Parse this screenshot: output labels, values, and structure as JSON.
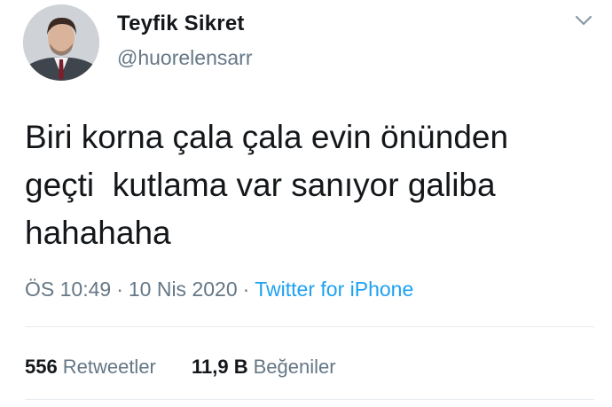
{
  "user": {
    "display_name": "Teyfik Sikret",
    "handle": "@huorelensarr"
  },
  "icons": {
    "avatar": "profile-photo",
    "caret": "chevron-down-icon"
  },
  "tweet": {
    "text": "Biri korna çala çala evin önünden\ngeçti  kutlama var sanıyor galiba\nhahahaha",
    "time": "ÖS 10:49",
    "date": "10 Nis 2020",
    "separator": "·",
    "source": "Twitter for iPhone"
  },
  "stats": {
    "retweets_count": "556",
    "retweets_label": "Retweetler",
    "likes_count": "11,9 B",
    "likes_label": "Beğeniler"
  },
  "colors": {
    "text": "#14171a",
    "secondary": "#657786",
    "link": "#1da1f2",
    "divider": "#e6ecf0"
  }
}
